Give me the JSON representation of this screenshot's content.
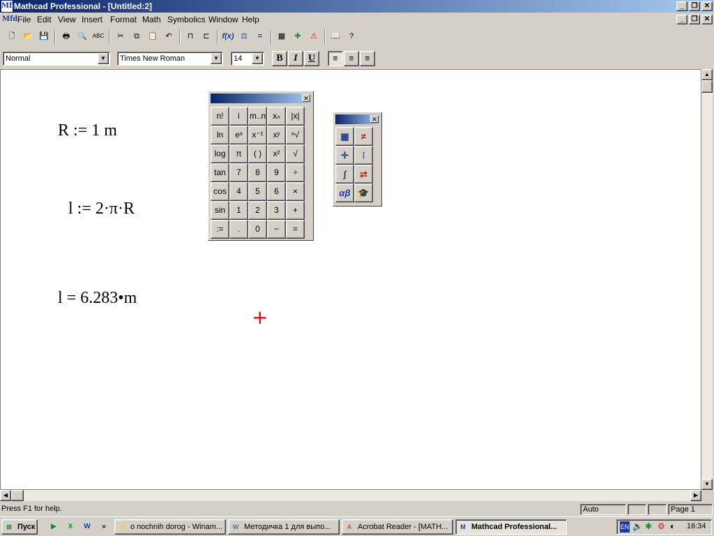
{
  "window": {
    "title": "Mathcad Professional - [Untitled:2]",
    "app_icon": "Mfd"
  },
  "menu": [
    "File",
    "Edit",
    "View",
    "Insert",
    "Format",
    "Math",
    "Symbolics",
    "Window",
    "Help"
  ],
  "format_bar": {
    "style": "Normal",
    "font": "Times New Roman",
    "size": "14",
    "bold": "B",
    "italic": "I",
    "underline": "U"
  },
  "worksheet": {
    "eq1": {
      "lhs": "R",
      "op": ":=",
      "rhs": "1 m"
    },
    "eq2": {
      "lhs": "l",
      "op": ":=",
      "rhs": "2·π·R"
    },
    "eq3": {
      "lhs": "l",
      "op": "=",
      "rhs": "6.283•m"
    },
    "cursor": "+"
  },
  "calculator": {
    "keys": [
      "n!",
      "i",
      "m..n",
      "xₙ",
      "|x|",
      "ln",
      "eˣ",
      "x⁻¹",
      "xʸ",
      "ⁿ√",
      "log",
      "π",
      "( )",
      "x²",
      "√",
      "tan",
      "7",
      "8",
      "9",
      "÷",
      "cos",
      "4",
      "5",
      "6",
      "×",
      "sin",
      "1",
      "2",
      "3",
      "+",
      ":=",
      ".",
      "0",
      "−",
      "="
    ]
  },
  "math_toolbar": {
    "icons": [
      "calculator-icon",
      "boolean-icon",
      "graph-icon",
      "matrix-icon",
      "calculus-icon",
      "programming-icon",
      "greek-icon",
      "symbolic-icon"
    ]
  },
  "status": {
    "help": "Press F1 for help.",
    "mode": "Auto",
    "page": "Page 1"
  },
  "taskbar": {
    "start": "Пуск",
    "tasks": [
      "o nochnih dorog - Winam...",
      "Методичка 1 для выпо...",
      "Acrobat Reader - [MATH...",
      "Mathcad Professional..."
    ],
    "lang": "EN",
    "clock": "16:34",
    "more": "»"
  }
}
